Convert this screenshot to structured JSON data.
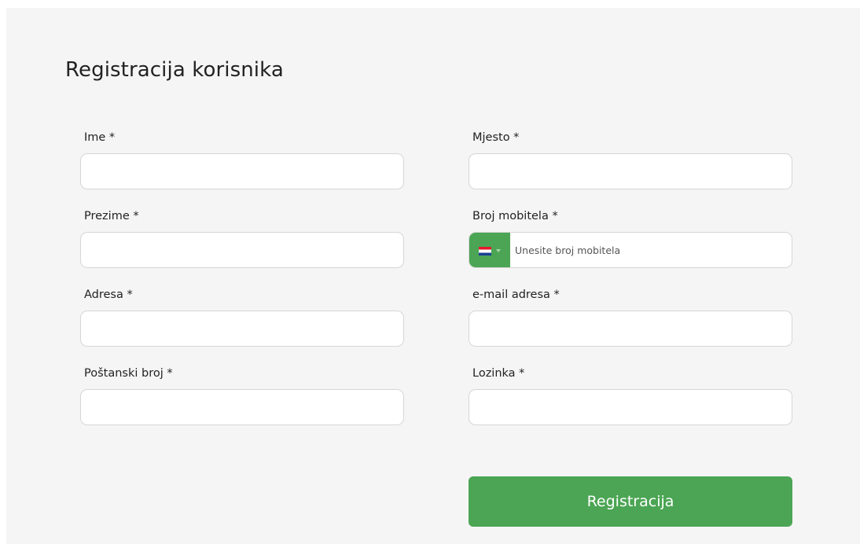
{
  "form": {
    "title": "Registracija korisnika",
    "left_fields": [
      {
        "label": "Ime *",
        "value": ""
      },
      {
        "label": "Prezime *",
        "value": ""
      },
      {
        "label": "Adresa *",
        "value": ""
      },
      {
        "label": "Poštanski broj *",
        "value": ""
      }
    ],
    "right_fields": [
      {
        "label": "Mjesto *",
        "value": ""
      },
      {
        "label": "Broj mobitela *",
        "placeholder": "Unesite broj mobitela",
        "value": "",
        "country_flag": "croatia-flag-icon"
      },
      {
        "label": "e-mail adresa *",
        "value": ""
      },
      {
        "label": "Lozinka *",
        "value": ""
      }
    ],
    "submit_label": "Registracija"
  },
  "colors": {
    "accent": "#4ba554",
    "card_background": "#f5f5f5",
    "input_border": "#d6d6d6"
  }
}
